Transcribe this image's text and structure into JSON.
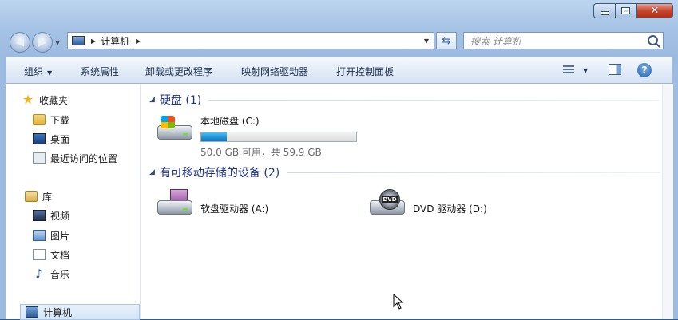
{
  "window": {
    "address_path": "计算机",
    "search_placeholder": "搜索 计算机"
  },
  "toolbar": {
    "organize": "组织",
    "system_properties": "系统属性",
    "uninstall": "卸载或更改程序",
    "map_drive": "映射网络驱动器",
    "control_panel": "打开控制面板"
  },
  "navpane": {
    "favorites": "收藏夹",
    "downloads": "下载",
    "desktop": "桌面",
    "recent": "最近访问的位置",
    "libraries": "库",
    "videos": "视频",
    "pictures": "图片",
    "documents": "文档",
    "music": "音乐",
    "computer": "计算机"
  },
  "groups": {
    "hard_disks": "硬盘 (1)",
    "removable": "有可移动存储的设备 (2)"
  },
  "drives": {
    "c": {
      "name": "本地磁盘 (C:)",
      "free_text": "50.0 GB 可用，共 59.9 GB",
      "used_fraction": 0.165
    },
    "a": {
      "name": "软盘驱动器 (A:)"
    },
    "d": {
      "name": "DVD 驱动器 (D:)"
    }
  },
  "colors": {
    "group_title": "#1e3287",
    "bar_fill": "#1f8fd6",
    "toolbar_bg": "#e3ecf8"
  },
  "icons": [
    "back-icon",
    "forward-icon",
    "computer-icon",
    "refresh-icon",
    "search-icon",
    "star-icon",
    "folder-icon",
    "desktop-icon",
    "recent-icon",
    "library-icon",
    "video-icon",
    "picture-icon",
    "document-icon",
    "music-icon",
    "hard-disk-icon",
    "floppy-drive-icon",
    "dvd-drive-icon",
    "view-options-icon",
    "preview-pane-icon",
    "help-icon"
  ]
}
